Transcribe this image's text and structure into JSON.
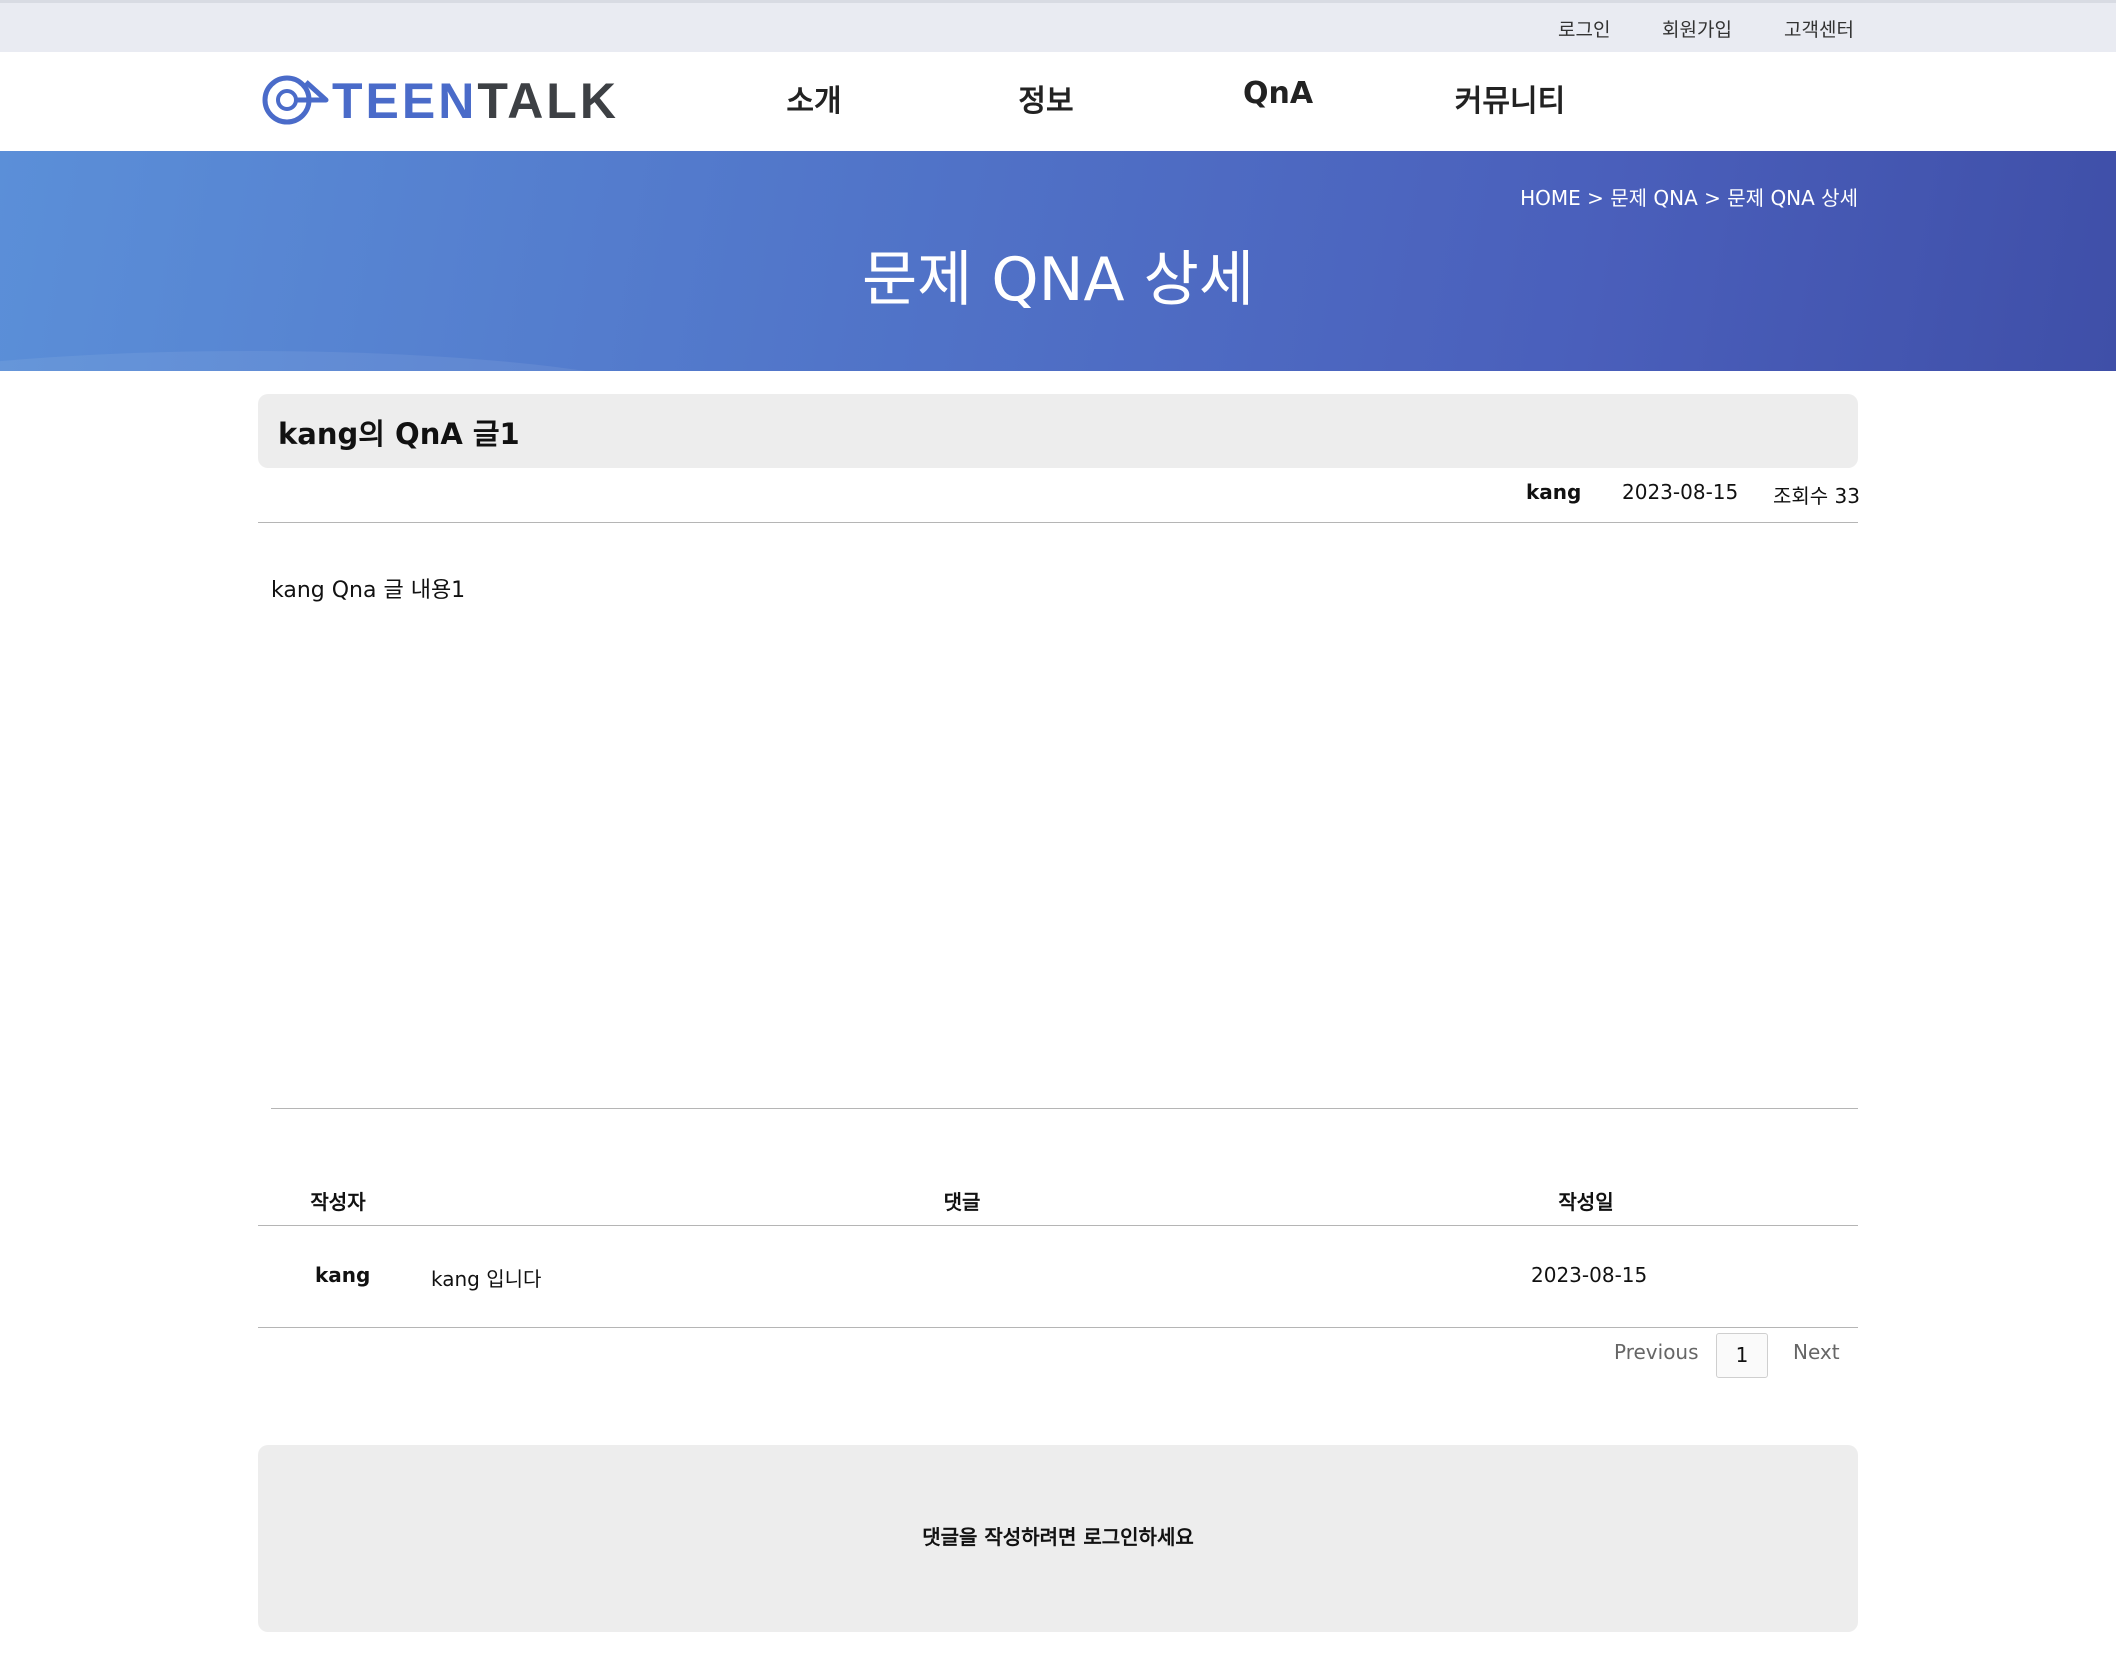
{
  "utility_nav": {
    "login": "로그인",
    "signup": "회원가입",
    "support": "고객센터"
  },
  "header": {
    "logo_text_accent": "TEEN",
    "logo_text_main": "TALK",
    "nav": [
      "소개",
      "정보",
      "QnA",
      "커뮤니티"
    ]
  },
  "banner": {
    "breadcrumb": "HOME > 문제 QNA > 문제 QNA 상세",
    "title": "문제 QNA 상세"
  },
  "post": {
    "title": "kang의 QnA 글1",
    "author": "kang",
    "date": "2023-08-15",
    "views": "조회수 33",
    "body": "kang Qna 글 내용1"
  },
  "comments": {
    "headers": [
      "작성자",
      "댓글",
      "작성일"
    ],
    "rows": [
      {
        "author": "kang",
        "content": "kang 입니다",
        "date": "2023-08-15"
      }
    ]
  },
  "pagination": {
    "previous": "Previous",
    "current": "1",
    "next": "Next"
  },
  "login_prompt": "댓글을 작성하려면 로그인하세요",
  "colors": {
    "banner_start": "#5b8fd8",
    "banner_end": "#3f4fa8",
    "logo_accent": "#4a6bc9"
  }
}
